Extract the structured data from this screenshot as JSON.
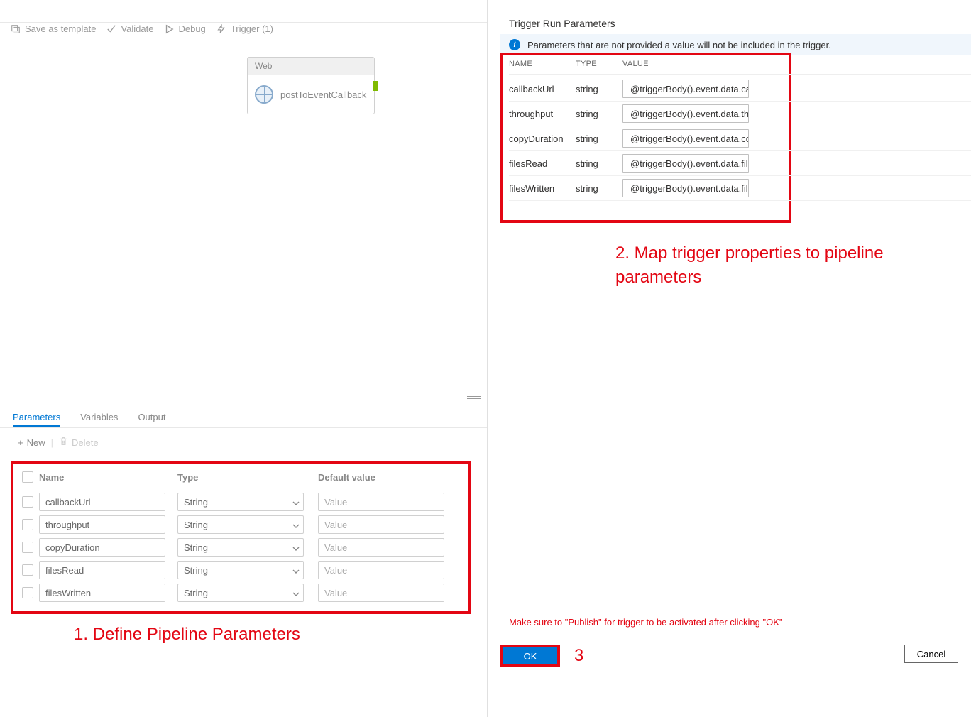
{
  "toolbar": {
    "save_template": "Save as template",
    "validate": "Validate",
    "debug": "Debug",
    "trigger": "Trigger (1)"
  },
  "canvas": {
    "node_type": "Web",
    "node_label": "postToEventCallback"
  },
  "tabs": {
    "parameters": "Parameters",
    "variables": "Variables",
    "output": "Output"
  },
  "actions": {
    "new_label": "New",
    "delete_label": "Delete"
  },
  "params_table": {
    "headers": {
      "name": "Name",
      "type": "Type",
      "default": "Default value"
    },
    "type_option": "String",
    "value_placeholder": "Value",
    "rows": [
      {
        "name": "callbackUrl"
      },
      {
        "name": "throughput"
      },
      {
        "name": "copyDuration"
      },
      {
        "name": "filesRead"
      },
      {
        "name": "filesWritten"
      }
    ]
  },
  "annotations": {
    "one": "1. Define Pipeline Parameters",
    "two": "2. Map trigger properties to pipeline parameters",
    "three": "3"
  },
  "panel": {
    "title": "Trigger Run Parameters",
    "info": "Parameters that are not provided a value will not be included in the trigger.",
    "headers": {
      "name": "NAME",
      "type": "TYPE",
      "value": "VALUE"
    },
    "rows": [
      {
        "name": "callbackUrl",
        "type": "string",
        "value": "@triggerBody().event.data.ca..."
      },
      {
        "name": "throughput",
        "type": "string",
        "value": "@triggerBody().event.data.th..."
      },
      {
        "name": "copyDuration",
        "type": "string",
        "value": "@triggerBody().event.data.co..."
      },
      {
        "name": "filesRead",
        "type": "string",
        "value": "@triggerBody().event.data.fil..."
      },
      {
        "name": "filesWritten",
        "type": "string",
        "value": "@triggerBody().event.data.fil..."
      }
    ],
    "publish_note": "Make sure to \"Publish\" for trigger to be activated after clicking \"OK\"",
    "ok": "OK",
    "cancel": "Cancel"
  }
}
